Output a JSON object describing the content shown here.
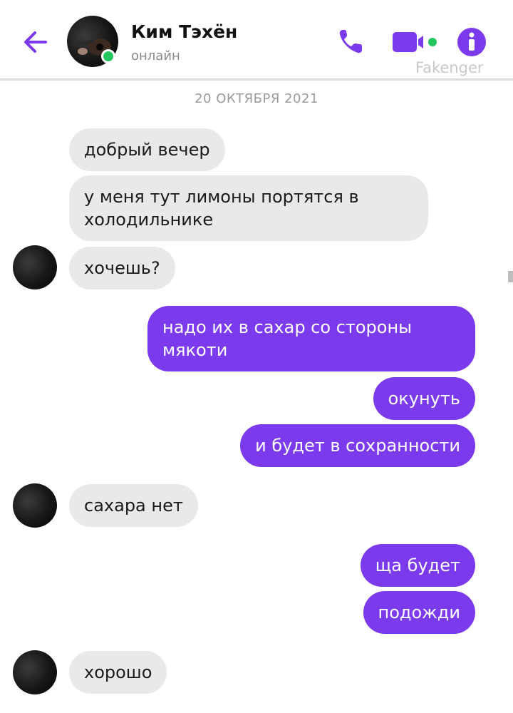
{
  "header": {
    "contact_name": "Ким Тэхён",
    "status": "онлайн",
    "watermark": "Fakenger",
    "icons": [
      "back-arrow-icon",
      "phone-icon",
      "video-camera-icon",
      "info-icon"
    ]
  },
  "colors": {
    "accent": "#7c3aed",
    "incoming_bubble": "#e9e9e9",
    "online": "#22c55e"
  },
  "date_divider": "20 ОКТЯБРЯ 2021",
  "messages": [
    {
      "direction": "in",
      "text": "добрый вечер"
    },
    {
      "direction": "in",
      "text": "у меня тут лимоны портятся в холодильнике"
    },
    {
      "direction": "in",
      "text": "хочешь?"
    },
    {
      "direction": "out",
      "text": "надо их в сахар со стороны мякоти"
    },
    {
      "direction": "out",
      "text": "окунуть"
    },
    {
      "direction": "out",
      "text": "и будет в сохранности"
    },
    {
      "direction": "in",
      "text": "сахара нет"
    },
    {
      "direction": "out",
      "text": "ща будет"
    },
    {
      "direction": "out",
      "text": "подожди"
    },
    {
      "direction": "in",
      "text": "хорошо"
    }
  ]
}
